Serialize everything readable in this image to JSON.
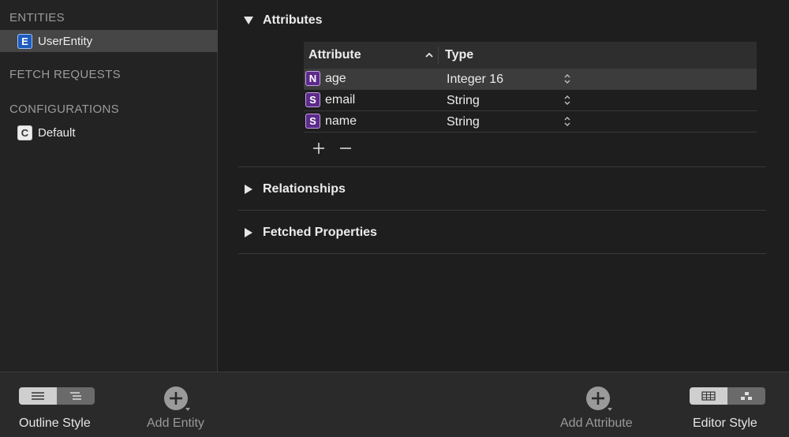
{
  "sidebar": {
    "entities_header": "ENTITIES",
    "entities": [
      {
        "badge": "E",
        "label": "UserEntity",
        "selected": true
      }
    ],
    "fetch_requests_header": "FETCH REQUESTS",
    "configurations_header": "CONFIGURATIONS",
    "configurations": [
      {
        "badge": "C",
        "label": "Default"
      }
    ]
  },
  "main": {
    "attributes_section": "Attributes",
    "table": {
      "col_attribute": "Attribute",
      "col_type": "Type",
      "rows": [
        {
          "badge": "N",
          "name": "age",
          "type": "Integer 16",
          "selected": true
        },
        {
          "badge": "S",
          "name": "email",
          "type": "String"
        },
        {
          "badge": "S",
          "name": "name",
          "type": "String"
        }
      ]
    },
    "relationships_section": "Relationships",
    "fetched_properties_section": "Fetched Properties"
  },
  "toolbar": {
    "outline_style": "Outline Style",
    "add_entity": "Add Entity",
    "add_attribute": "Add Attribute",
    "editor_style": "Editor Style"
  },
  "icons": {
    "disclosure_open": "triangle-down-icon",
    "disclosure_closed": "triangle-right-icon",
    "add": "plus-icon",
    "remove": "minus-icon",
    "stepper": "updown-chevron-icon"
  },
  "colors": {
    "entity_badge": "#1e5bbd",
    "attribute_badge": "#5c2a8a",
    "selection": "#464646"
  }
}
